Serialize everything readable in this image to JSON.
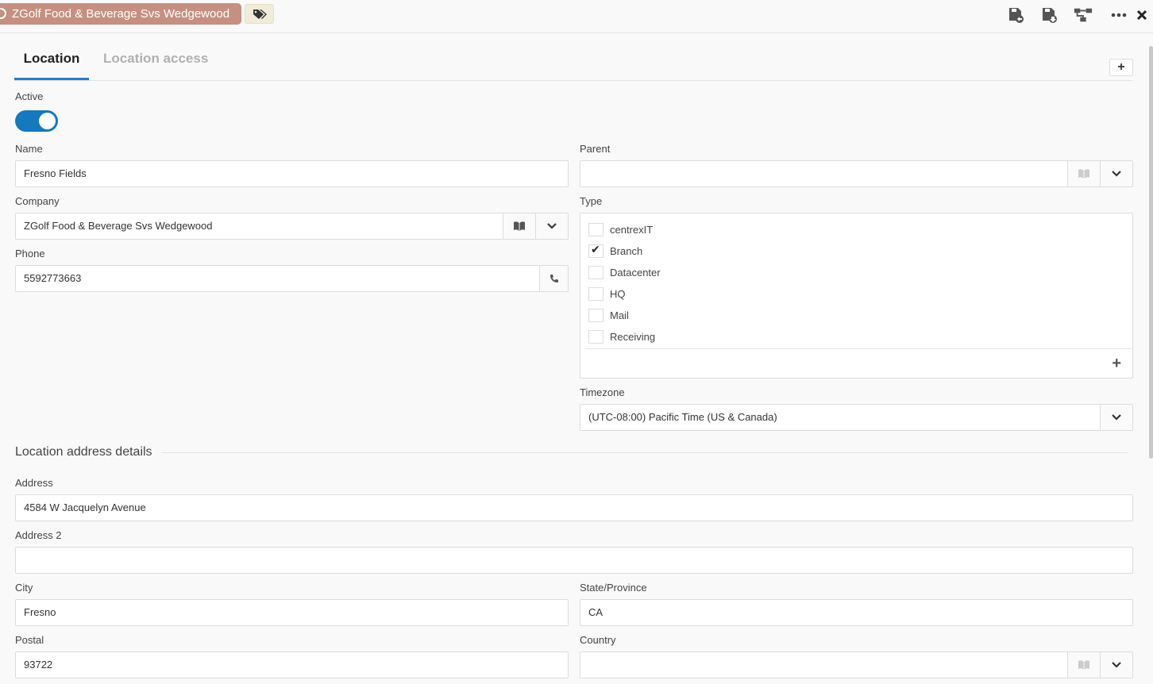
{
  "header": {
    "record_title": "ZGolf Food & Beverage Svs Wedgewood",
    "icons": [
      "tags-icon",
      "back-save-icon",
      "save-icon",
      "hierarchy-icon",
      "more-icon",
      "close-icon"
    ]
  },
  "tabs": [
    {
      "label": "Location",
      "active": true
    },
    {
      "label": "Location access",
      "active": false
    }
  ],
  "form": {
    "active_label": "Active",
    "active_value": true,
    "name_label": "Name",
    "name_value": "Fresno Fields",
    "parent_label": "Parent",
    "parent_value": "",
    "company_label": "Company",
    "company_value": "ZGolf Food & Beverage Svs Wedgewood",
    "phone_label": "Phone",
    "phone_value": "5592773663",
    "type_label": "Type",
    "type_options": [
      {
        "label": "centrexIT",
        "checked": false
      },
      {
        "label": "Branch",
        "checked": true
      },
      {
        "label": "Datacenter",
        "checked": false
      },
      {
        "label": "HQ",
        "checked": false
      },
      {
        "label": "Mail",
        "checked": false
      },
      {
        "label": "Receiving",
        "checked": false
      }
    ],
    "timezone_label": "Timezone",
    "timezone_value": "(UTC-08:00) Pacific Time (US & Canada)"
  },
  "address_section": {
    "title": "Location address details",
    "address_label": "Address",
    "address_value": "4584 W Jacquelyn Avenue",
    "address2_label": "Address 2",
    "address2_value": "",
    "city_label": "City",
    "city_value": "Fresno",
    "state_label": "State/Province",
    "state_value": "CA",
    "postal_label": "Postal",
    "postal_value": "93722",
    "country_label": "Country",
    "country_value": ""
  },
  "colors": {
    "accent": "#1479bf",
    "record_chip": "#c58f81",
    "tab_underline": "#2d7dbf"
  }
}
